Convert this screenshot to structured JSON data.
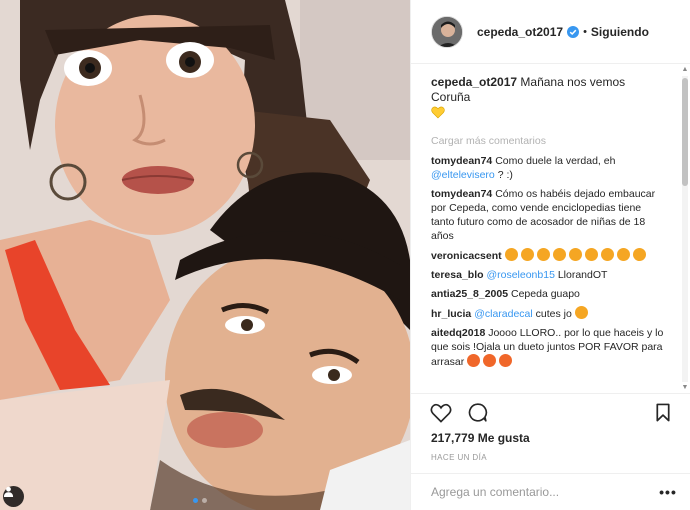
{
  "post": {
    "username": "cepeda_ot2017",
    "follow_state": "Siguiendo",
    "separator": "•",
    "caption_user": "cepeda_ot2017",
    "caption_text": "Mañana nos vemos Coruña",
    "load_more": "Cargar más comentarios",
    "likes": "217,779 Me gusta",
    "time_ago": "HACE UN DÍA",
    "add_comment_placeholder": "Agrega un comentario...",
    "more_label": "•••"
  },
  "comments": [
    {
      "user": "tomydean74",
      "text": "Como duele la verdad, eh ",
      "mention": "@eltelevisero",
      "tail": " ? :)"
    },
    {
      "user": "tomydean74",
      "text": "Cómo os habéis dejado embaucar por Cepeda, como vende enciclopedias tiene tanto futuro como de acosador de niñas de 18 años",
      "mention": "",
      "tail": ""
    },
    {
      "user": "veronicacsent",
      "text": "",
      "mention": "",
      "tail": ""
    },
    {
      "user": "teresa_blo",
      "text": "",
      "mention": "@roseleonb15",
      "tail": " LlorandOT"
    },
    {
      "user": "antia25_8_2005",
      "text": "Cepeda guapo",
      "mention": "",
      "tail": ""
    },
    {
      "user": "hr_lucia",
      "text": "",
      "mention": "@claradecal",
      "tail": " cutes jo "
    },
    {
      "user": "aitedq2018",
      "text": "Joooo LLORO.. por lo que haceis y lo que sois !Ojala un dueto juntos POR FAVOR para arrasar ",
      "mention": "",
      "tail": ""
    }
  ],
  "emoji_counts": {
    "veronicacsent": 9,
    "aitedq2018": 3
  },
  "colors": {
    "verified": "#3897f0",
    "mention": "#3897f0",
    "emoji_face": "#f5a623",
    "emoji_fire": "#f0672a",
    "heart_yellow": "#ffcc33"
  },
  "icons": [
    "verified-badge-icon",
    "heart-icon",
    "comment-icon",
    "bookmark-icon",
    "tag-user-icon",
    "yellow-heart-icon"
  ]
}
